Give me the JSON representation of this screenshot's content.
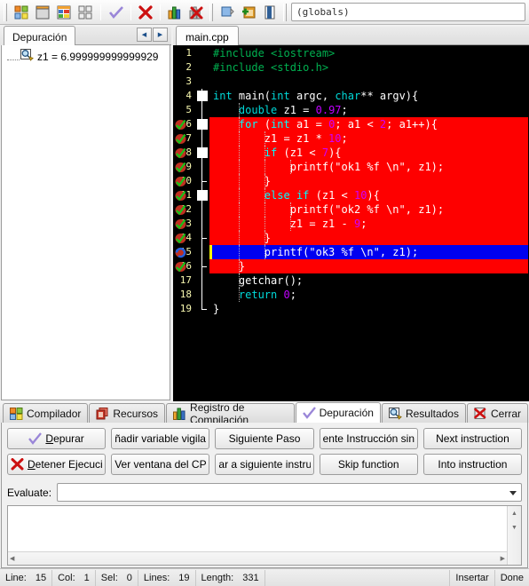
{
  "toolbar": {
    "groups": [
      {
        "name": "project-group",
        "icons": [
          "new-project-icon",
          "new-window-icon",
          "project-options-icon",
          "tile-icon"
        ]
      },
      {
        "name": "compile-group",
        "icons": [
          "compile-check-icon",
          "stop-red-x-icon"
        ]
      },
      {
        "name": "profile-group",
        "icons": [
          "profiling-chart-icon",
          "delete-profile-icon"
        ]
      },
      {
        "name": "window-group",
        "icons": [
          "copy-window-icon",
          "add-window-icon",
          "book-icon"
        ]
      }
    ],
    "globals_combo": "(globals)"
  },
  "left_panel": {
    "tab_label": "Depuración",
    "nav_prev_icon": "arrow-left-icon",
    "nav_next_icon": "arrow-right-icon",
    "watch_icon": "magnifier-icon",
    "watch_items": [
      {
        "text": "z1 = 6.999999999999929"
      }
    ]
  },
  "editor": {
    "tab_label": "main.cpp",
    "current_line": 15,
    "lines": [
      {
        "n": "1",
        "indent": 0,
        "state": "normal",
        "gutter_icon": "",
        "fold": "none",
        "tokens": [
          {
            "t": "#include ",
            "c": "pre"
          },
          {
            "t": "<iostream>",
            "c": "pre2"
          }
        ]
      },
      {
        "n": "2",
        "indent": 0,
        "state": "normal",
        "gutter_icon": "",
        "fold": "none",
        "tokens": [
          {
            "t": "#include ",
            "c": "pre"
          },
          {
            "t": "<stdio.h>",
            "c": "pre2"
          }
        ]
      },
      {
        "n": "3",
        "indent": 0,
        "state": "normal",
        "gutter_icon": "",
        "fold": "none",
        "tokens": []
      },
      {
        "n": "4",
        "indent": 0,
        "state": "normal",
        "gutter_icon": "",
        "fold": "box",
        "tokens": [
          {
            "t": "int",
            "c": "kw"
          },
          {
            "t": " main(",
            "c": "plain"
          },
          {
            "t": "int",
            "c": "kw"
          },
          {
            "t": " argc, ",
            "c": "plain"
          },
          {
            "t": "char",
            "c": "kw"
          },
          {
            "t": "** argv){",
            "c": "plain"
          }
        ]
      },
      {
        "n": "5",
        "indent": 1,
        "state": "normal",
        "gutter_icon": "",
        "fold": "line",
        "tokens": [
          {
            "t": "    ",
            "c": "plain"
          },
          {
            "t": "double",
            "c": "kw"
          },
          {
            "t": " z1 = ",
            "c": "plain"
          },
          {
            "t": "0.97",
            "c": "num"
          },
          {
            "t": ";",
            "c": "plain"
          }
        ]
      },
      {
        "n": "6",
        "indent": 1,
        "state": "red",
        "gutter_icon": "executed-check-icon",
        "fold": "box",
        "tokens": [
          {
            "t": "    ",
            "c": "plain"
          },
          {
            "t": "for",
            "c": "redkw"
          },
          {
            "t": " (",
            "c": "plain"
          },
          {
            "t": "int",
            "c": "redkw"
          },
          {
            "t": " a1 = ",
            "c": "plain"
          },
          {
            "t": "0",
            "c": "rednum"
          },
          {
            "t": "; a1 < ",
            "c": "plain"
          },
          {
            "t": "2",
            "c": "rednum"
          },
          {
            "t": "; a1++){",
            "c": "plain"
          }
        ]
      },
      {
        "n": "7",
        "indent": 2,
        "state": "red",
        "gutter_icon": "executed-check-icon",
        "fold": "line",
        "tokens": [
          {
            "t": "        z1 = z1 * ",
            "c": "plain"
          },
          {
            "t": "10",
            "c": "rednum"
          },
          {
            "t": ";",
            "c": "plain"
          }
        ]
      },
      {
        "n": "8",
        "indent": 2,
        "state": "red",
        "gutter_icon": "executed-check-icon",
        "fold": "box",
        "tokens": [
          {
            "t": "        ",
            "c": "plain"
          },
          {
            "t": "if",
            "c": "redkw"
          },
          {
            "t": " (z1 < ",
            "c": "plain"
          },
          {
            "t": "7",
            "c": "rednum"
          },
          {
            "t": "){",
            "c": "plain"
          }
        ]
      },
      {
        "n": "9",
        "indent": 3,
        "state": "red",
        "gutter_icon": "executed-check-icon",
        "fold": "line",
        "tokens": [
          {
            "t": "            printf(",
            "c": "plain"
          },
          {
            "t": "\"ok1 %f \\n\"",
            "c": "str"
          },
          {
            "t": ", z1);",
            "c": "plain"
          }
        ]
      },
      {
        "n": "10",
        "indent": 2,
        "state": "red",
        "gutter_icon": "executed-check-icon",
        "fold": "tick",
        "tokens": [
          {
            "t": "        }",
            "c": "plain"
          }
        ]
      },
      {
        "n": "11",
        "indent": 2,
        "state": "red",
        "gutter_icon": "executed-check-icon",
        "fold": "box",
        "tokens": [
          {
            "t": "        ",
            "c": "plain"
          },
          {
            "t": "else",
            "c": "redkw"
          },
          {
            "t": " ",
            "c": "plain"
          },
          {
            "t": "if",
            "c": "redkw"
          },
          {
            "t": " (z1 < ",
            "c": "plain"
          },
          {
            "t": "10",
            "c": "rednum"
          },
          {
            "t": "){",
            "c": "plain"
          }
        ]
      },
      {
        "n": "12",
        "indent": 3,
        "state": "red",
        "gutter_icon": "executed-check-icon",
        "fold": "line",
        "tokens": [
          {
            "t": "            printf(",
            "c": "plain"
          },
          {
            "t": "\"ok2 %f \\n\"",
            "c": "str"
          },
          {
            "t": ", z1);",
            "c": "plain"
          }
        ]
      },
      {
        "n": "13",
        "indent": 3,
        "state": "red",
        "gutter_icon": "executed-check-icon",
        "fold": "line",
        "tokens": [
          {
            "t": "            z1 = z1 - ",
            "c": "plain"
          },
          {
            "t": "9",
            "c": "rednum"
          },
          {
            "t": ";",
            "c": "plain"
          }
        ]
      },
      {
        "n": "14",
        "indent": 2,
        "state": "red",
        "gutter_icon": "executed-check-icon",
        "fold": "tick",
        "tokens": [
          {
            "t": "        }",
            "c": "plain"
          }
        ]
      },
      {
        "n": "15",
        "indent": 2,
        "state": "blue",
        "gutter_icon": "current-line-arrow-icon",
        "fold": "line",
        "tokens": [
          {
            "t": "        printf(",
            "c": "plain"
          },
          {
            "t": "\"ok3 %f \\n\"",
            "c": "str"
          },
          {
            "t": ", z1);",
            "c": "plain"
          }
        ]
      },
      {
        "n": "16",
        "indent": 1,
        "state": "red",
        "gutter_icon": "executed-check-icon",
        "fold": "tick",
        "tokens": [
          {
            "t": "    }",
            "c": "plain"
          }
        ]
      },
      {
        "n": "17",
        "indent": 1,
        "state": "normal",
        "gutter_icon": "",
        "fold": "line",
        "tokens": [
          {
            "t": "    getchar();",
            "c": "plain"
          }
        ]
      },
      {
        "n": "18",
        "indent": 1,
        "state": "normal",
        "gutter_icon": "",
        "fold": "line",
        "tokens": [
          {
            "t": "    ",
            "c": "plain"
          },
          {
            "t": "return",
            "c": "kw"
          },
          {
            "t": " ",
            "c": "plain"
          },
          {
            "t": "0",
            "c": "num"
          },
          {
            "t": ";",
            "c": "plain"
          }
        ]
      },
      {
        "n": "19",
        "indent": 0,
        "state": "normal",
        "gutter_icon": "",
        "fold": "end",
        "tokens": [
          {
            "t": "}",
            "c": "plain"
          }
        ]
      }
    ]
  },
  "bottom_tabs": [
    {
      "label": "Compilador",
      "icon": "compiler-icon",
      "active": false
    },
    {
      "label": "Recursos",
      "icon": "resources-icon",
      "active": false
    },
    {
      "label": "Registro de Compilación",
      "icon": "log-chart-icon",
      "active": false
    },
    {
      "label": "Depuración",
      "icon": "check-icon",
      "active": true
    },
    {
      "label": "Resultados",
      "icon": "magnifier-icon",
      "active": false
    },
    {
      "label": "Cerrar",
      "icon": "close-red-icon",
      "active": false
    }
  ],
  "debug_buttons": {
    "row1": [
      {
        "label": "Depurar",
        "icon": "check-icon",
        "underline_index": 0
      },
      {
        "label": "ñadir variable vigilad",
        "icon": "",
        "underline_index": -1
      },
      {
        "label": "Siguiente Paso",
        "icon": "",
        "underline_index": -1
      },
      {
        "label": "ente Instrucción sin e",
        "icon": "",
        "underline_index": -1
      },
      {
        "label": "Next instruction",
        "icon": "",
        "underline_index": -1
      }
    ],
    "row2": [
      {
        "label": "Detener Ejecución",
        "icon": "stop-red-x-icon",
        "underline_index": 0
      },
      {
        "label": "Ver ventana del CPU",
        "icon": "",
        "underline_index": -1
      },
      {
        "label": "ar a siguiente instruc",
        "icon": "",
        "underline_index": -1
      },
      {
        "label": "Skip function",
        "icon": "",
        "underline_index": -1
      },
      {
        "label": "Into instruction",
        "icon": "",
        "underline_index": -1
      }
    ]
  },
  "evaluate": {
    "label": "Evaluate:",
    "value": "",
    "placeholder": "",
    "dropdown_icon": "chevron-down-icon",
    "output": ""
  },
  "statusbar": {
    "line_key": "Line:",
    "line_value": "15",
    "col_key": "Col:",
    "col_value": "1",
    "sel_key": "Sel:",
    "sel_value": "0",
    "lines_key": "Lines:",
    "lines_value": "19",
    "length_key": "Length:",
    "length_value": "331",
    "mode": "Insertar",
    "state": "Done"
  },
  "colors": {
    "breakpoint_red": "#fe0000",
    "current_line_blue": "#0000f0",
    "editor_bg": "#000000",
    "keyword_cyan": "#00d8d8",
    "number_purple": "#c000ff",
    "preproc_green": "#00b050",
    "gutter_yellow": "#f8f8b0"
  }
}
